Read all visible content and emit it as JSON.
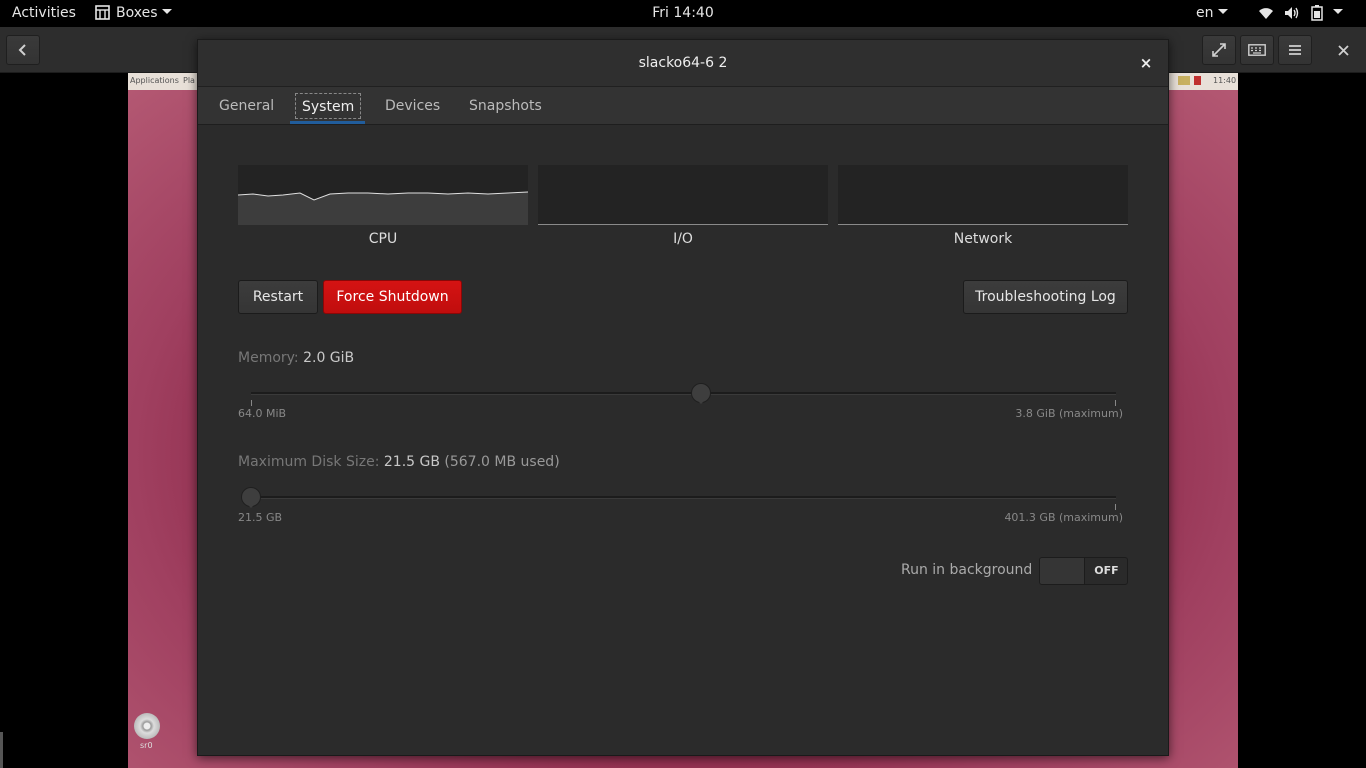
{
  "topbar": {
    "activities": "Activities",
    "app_menu": "Boxes",
    "clock": "Fri 14:40",
    "language": "en",
    "icons": [
      "wifi-icon",
      "volume-icon",
      "battery-icon"
    ]
  },
  "guest": {
    "panel_left": "Applications",
    "panel_places": "Pla",
    "panel_time": "11:40",
    "cd_label": "sr0"
  },
  "dialog": {
    "title": "slacko64-6 2",
    "close": "×",
    "tabs": [
      {
        "label": "General"
      },
      {
        "label": "System"
      },
      {
        "label": "Devices"
      },
      {
        "label": "Snapshots"
      }
    ],
    "active_tab": "System",
    "graphs": [
      {
        "label": "CPU"
      },
      {
        "label": "I/O"
      },
      {
        "label": "Network"
      }
    ],
    "buttons": {
      "restart": "Restart",
      "force_shutdown": "Force Shutdown",
      "troubleshooting_log": "Troubleshooting Log"
    },
    "memory": {
      "label": "Memory:",
      "value": "2.0 GiB",
      "min_label": "64.0 MiB",
      "max_label": "3.8 GiB (maximum)",
      "level": 0.52
    },
    "disk": {
      "label": "Maximum Disk Size:",
      "value": "21.5 GB",
      "used": "(567.0 MB used)",
      "min_label": "21.5 GB",
      "max_label": "401.3 GB (maximum)",
      "level": 0.0
    },
    "run_in_background": {
      "label": "Run in background",
      "state": "OFF"
    }
  },
  "colors": {
    "accent": "#215d9c",
    "danger": "#cc1111",
    "dialog_bg": "#2b2b2b"
  }
}
